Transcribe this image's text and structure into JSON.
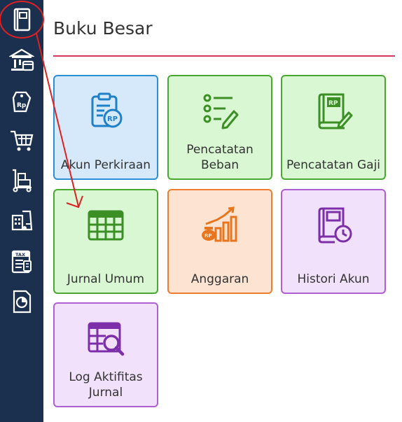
{
  "page": {
    "title": "Buku Besar"
  },
  "sidebar": {
    "items": [
      {
        "name": "ledger-book-icon"
      },
      {
        "name": "bank-icon"
      },
      {
        "name": "rupiah-tag-icon"
      },
      {
        "name": "shopping-cart-icon"
      },
      {
        "name": "hand-truck-icon"
      },
      {
        "name": "warehouse-icon"
      },
      {
        "name": "tax-document-icon"
      },
      {
        "name": "pie-report-icon"
      }
    ]
  },
  "tiles": [
    {
      "label": "Akun Perkiraan",
      "theme": "blue",
      "icon": "rp-clipboard-icon"
    },
    {
      "label": "Pencatatan Beban",
      "theme": "green",
      "icon": "checklist-icon"
    },
    {
      "label": "Pencatatan Gaji",
      "theme": "green",
      "icon": "rp-book-icon"
    },
    {
      "label": "Jurnal Umum",
      "theme": "green",
      "icon": "table-icon"
    },
    {
      "label": "Anggaran",
      "theme": "orange",
      "icon": "budget-growth-icon"
    },
    {
      "label": "Histori Akun",
      "theme": "purple",
      "icon": "history-book-icon"
    },
    {
      "label": "Log Aktifitas Jurnal",
      "theme": "purple",
      "icon": "table-search-icon"
    }
  ],
  "colors": {
    "sidebar_bg": "#1b2f4f",
    "accent_rule": "#d4385a",
    "annotation_red": "#e02020",
    "blue": "#2b8fd6",
    "green": "#4aa831",
    "orange": "#ef7d2f",
    "purple": "#8e3fb8"
  }
}
